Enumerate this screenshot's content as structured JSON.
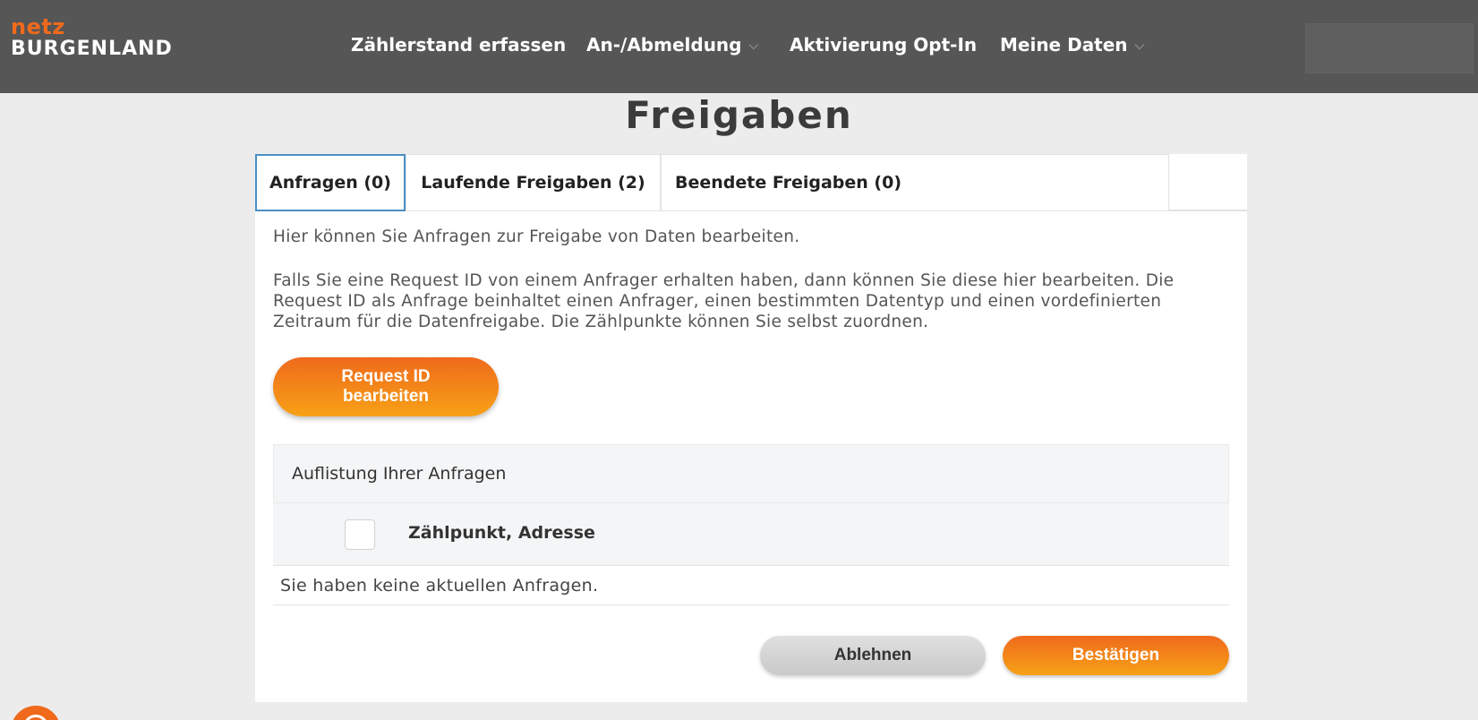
{
  "brand": {
    "line1": "netz",
    "line2": "BURGENLAND"
  },
  "nav": {
    "items": [
      {
        "label": "Zählerstand erfassen",
        "has_dropdown": false
      },
      {
        "label": "An-/Abmeldung",
        "has_dropdown": true
      },
      {
        "label": "Aktivierung Opt-In",
        "has_dropdown": false
      },
      {
        "label": "Meine Daten",
        "has_dropdown": true
      }
    ],
    "chevron": "⌵"
  },
  "page_title": "Freigaben",
  "tabs": [
    {
      "label": "Anfragen (0)",
      "active": true
    },
    {
      "label": "Laufende Freigaben (2)",
      "active": false
    },
    {
      "label": "Beendete Freigaben (0)",
      "active": false
    }
  ],
  "content": {
    "intro": "Hier können Sie Anfragen zur Freigabe von Daten bearbeiten.",
    "description": "Falls Sie eine Request ID von einem Anfrager erhalten haben, dann können Sie diese hier bearbeiten. Die Request ID als Anfrage beinhaltet einen Anfrager, einen bestimmten Datentyp und einen vordefinierten Zeitraum für die Datenfreigabe. Die Zählpunkte können Sie selbst zuordnen.",
    "request_button": "Request ID bearbeiten"
  },
  "list": {
    "header": "Auflistung Ihrer Anfragen",
    "column_label": "Zählpunkt, Adresse",
    "select_all_checked": false,
    "empty_message": "Sie haben keine aktuellen Anfragen."
  },
  "actions": {
    "decline": "Ablehnen",
    "confirm": "Bestätigen"
  },
  "colors": {
    "header_bg": "#565656",
    "brand_orange": "#ef6a1c",
    "button_gradient_end": "#f7a116",
    "active_tab_border": "#4a8fc4"
  }
}
